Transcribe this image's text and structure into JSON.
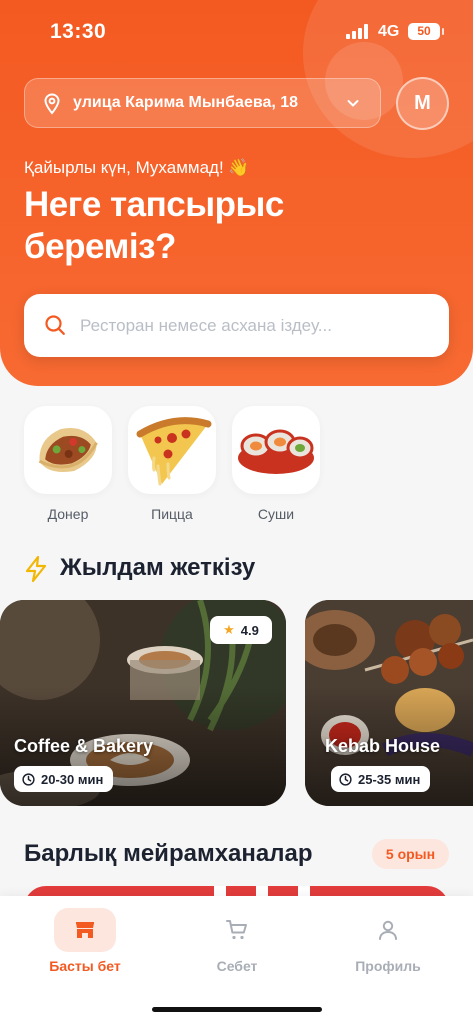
{
  "status_bar": {
    "time": "13:30",
    "network": "4G",
    "battery": "50"
  },
  "header": {
    "address": "улица Карима Мынбаева, 18",
    "avatar_initial": "M",
    "greeting": "Қайырлы күн, Мухаммад! 👋",
    "headline": "Неге тапсырыс береміз?",
    "search_placeholder": "Ресторан немесе асхана іздеу..."
  },
  "categories": [
    {
      "label": "Донер",
      "icon": "doner-image"
    },
    {
      "label": "Пицца",
      "icon": "pizza-image"
    },
    {
      "label": "Суши",
      "icon": "sushi-image"
    }
  ],
  "fast_delivery": {
    "title": "Жылдам жеткізу",
    "icon": "lightning-icon",
    "cards": [
      {
        "name": "Coffee & Bakery",
        "eta": "20-30 мин",
        "rating": "4.9"
      },
      {
        "name": "Kebab House",
        "eta": "25-35 мин"
      }
    ]
  },
  "all_restaurants": {
    "title": "Барлық мейрамханалар",
    "count": "5 орын"
  },
  "bottom_nav": [
    {
      "label": "Басты бет",
      "icon": "store-icon",
      "active": true
    },
    {
      "label": "Себет",
      "icon": "cart-icon",
      "active": false
    },
    {
      "label": "Профиль",
      "icon": "user-icon",
      "active": false
    }
  ],
  "colors": {
    "accent": "#f35a22",
    "accent_soft": "#fde6de",
    "text_dark": "#1c2230",
    "muted": "#a9aeb6",
    "star": "#f5a623"
  }
}
